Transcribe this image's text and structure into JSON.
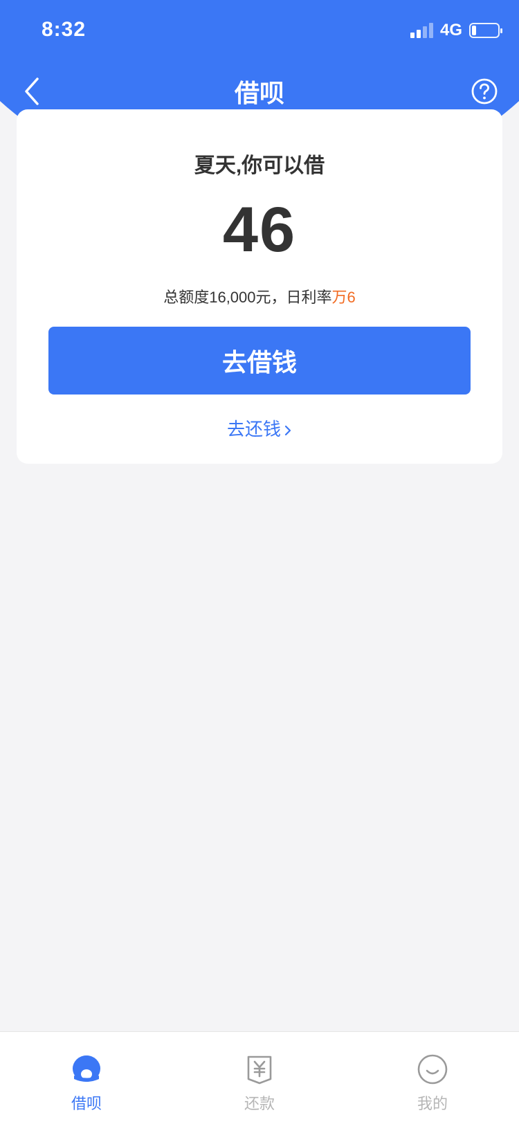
{
  "status_bar": {
    "time": "8:32",
    "network": "4G"
  },
  "nav": {
    "title": "借呗",
    "back_icon": "chevron-left-icon",
    "help_icon": "question-circle-icon"
  },
  "card": {
    "greeting": "夏天,你可以借",
    "amount": "46",
    "limit_prefix": "总额度16,000元，日利率",
    "rate": "万6",
    "borrow_button": "去借钱",
    "repay_link": "去还钱"
  },
  "tabs": [
    {
      "label": "借呗",
      "icon": "jiebei-icon",
      "active": true
    },
    {
      "label": "还款",
      "icon": "repay-yen-icon",
      "active": false
    },
    {
      "label": "我的",
      "icon": "smiley-icon",
      "active": false
    }
  ],
  "colors": {
    "brand": "#3b77f5",
    "rate": "#f26b22",
    "inactive": "#b5b5b5",
    "background": "#f4f4f6"
  }
}
